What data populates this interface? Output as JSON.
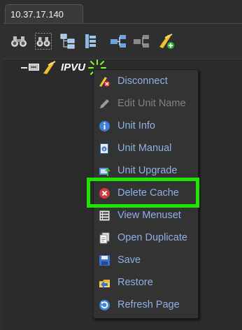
{
  "window": {
    "tab_label": "10.37.17.140"
  },
  "toolbar": {
    "buttons": [
      {
        "icon": "binoculars-icon"
      },
      {
        "icon": "binoculars-selected-icon"
      },
      {
        "icon": "tree-expand-icon"
      },
      {
        "icon": "tree-collapse-icon"
      },
      {
        "icon": "network-connect-icon"
      },
      {
        "icon": "network-disconnect-icon"
      },
      {
        "icon": "add-unit-icon"
      }
    ]
  },
  "tree": {
    "node_label": "IPVU"
  },
  "context_menu": {
    "items": [
      {
        "label": "Disconnect",
        "icon": "disconnect-icon",
        "enabled": true
      },
      {
        "label": "Edit Unit Name",
        "icon": "pencil-icon",
        "enabled": false
      },
      {
        "label": "Unit Info",
        "icon": "info-icon",
        "enabled": true
      },
      {
        "label": "Unit Manual",
        "icon": "manual-icon",
        "enabled": true
      },
      {
        "label": "Unit Upgrade",
        "icon": "upgrade-icon",
        "enabled": true
      },
      {
        "label": "Delete Cache",
        "icon": "delete-icon",
        "enabled": true,
        "highlighted": true
      },
      {
        "label": "View Menuset",
        "icon": "list-icon",
        "enabled": true
      },
      {
        "label": "Open Duplicate",
        "icon": "duplicate-icon",
        "enabled": true
      },
      {
        "label": "Save",
        "icon": "save-icon",
        "enabled": true
      },
      {
        "label": "Restore",
        "icon": "restore-icon",
        "enabled": true
      },
      {
        "label": "Refresh Page",
        "icon": "refresh-icon",
        "enabled": true
      }
    ]
  },
  "colors": {
    "highlight_border": "#1ee600",
    "menu_text": "#8fb1e6",
    "disabled_text": "#828282"
  }
}
